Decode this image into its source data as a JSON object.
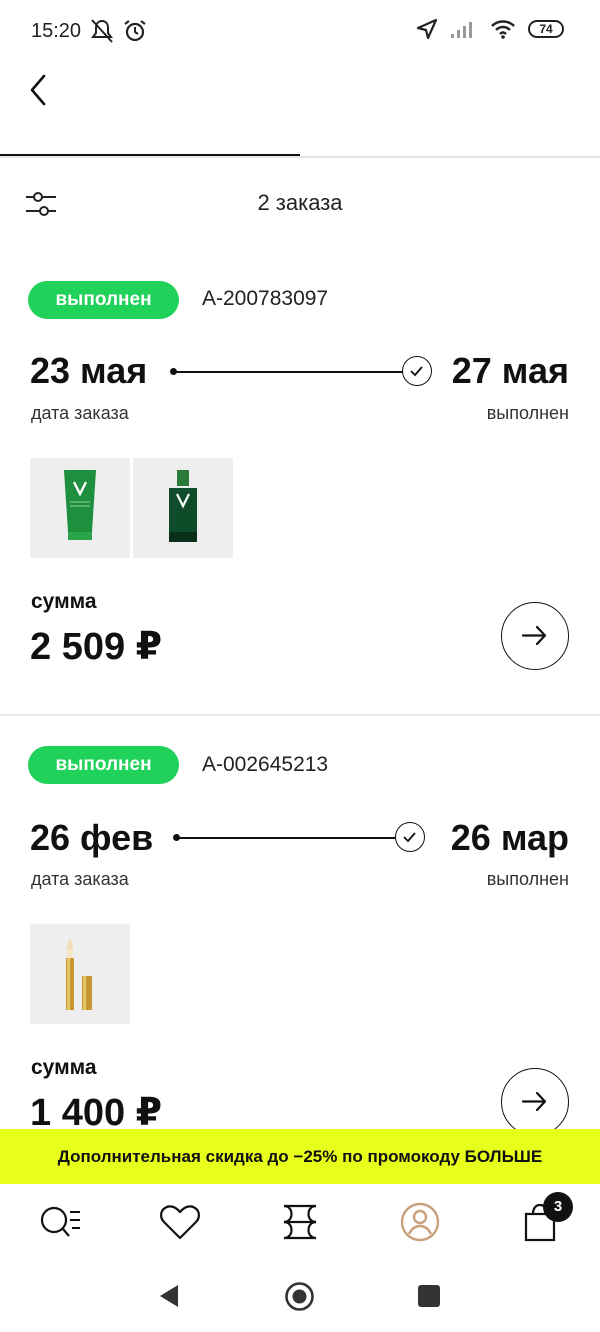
{
  "status_bar": {
    "time": "15:20",
    "battery": "74",
    "icons": [
      "mute-icon",
      "alarm-icon",
      "location-icon",
      "signal-icon",
      "wifi-icon",
      "battery-icon"
    ]
  },
  "header": {
    "back_icon": "chevron-left-icon"
  },
  "toolbar": {
    "filter_icon": "filter-sliders-icon",
    "orders_count": "2 заказа"
  },
  "orders": [
    {
      "status": "выполнен",
      "id": "А-200783097",
      "order_date": "23 мая",
      "order_date_label": "дата заказа",
      "done_date": "27 мая",
      "done_label": "выполнен",
      "products": [
        "vichy-tube-image",
        "vichy-serum-image"
      ],
      "sum_label": "сумма",
      "sum_value": "2 509 ₽"
    },
    {
      "status": "выполнен",
      "id": "А-002645213",
      "order_date": "26 фев",
      "order_date_label": "дата заказа",
      "done_date": "26 мар",
      "done_label": "выполнен",
      "products": [
        "gold-concealer-image"
      ],
      "sum_label": "сумма",
      "sum_value": "1 400 ₽"
    }
  ],
  "promo": {
    "text": "Дополнительная скидка до −25% по промокоду БОЛЬШЕ"
  },
  "bottom_nav": {
    "items": [
      "catalog-search-icon",
      "heart-icon",
      "brand-logo-icon",
      "profile-icon",
      "bag-icon"
    ],
    "active": "profile-icon",
    "cart_count": "3"
  },
  "colors": {
    "status_green": "#21d25a",
    "promo_yellow": "#e8ff1c",
    "active_nav": "#c9a27a"
  }
}
